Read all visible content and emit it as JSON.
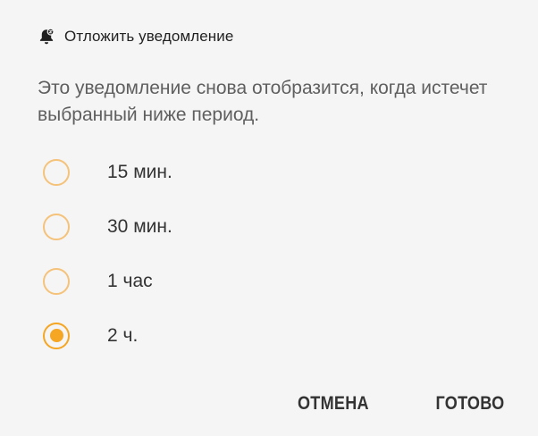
{
  "header": {
    "icon": "snooze-bell-icon",
    "title": "Отложить уведомление"
  },
  "description": "Это уведомление снова отобразится, когда истечет выбранный ниже период.",
  "options": [
    {
      "label": "15 мин.",
      "selected": false
    },
    {
      "label": "30 мин.",
      "selected": false
    },
    {
      "label": "1 час",
      "selected": false
    },
    {
      "label": "2 ч.",
      "selected": true
    }
  ],
  "actions": {
    "cancel_label": "ОТМЕНА",
    "done_label": "ГОТОВО"
  },
  "colors": {
    "accent": "#f5a623",
    "radio_unselected": "#f5c27a",
    "background": "#f5f5f5"
  }
}
